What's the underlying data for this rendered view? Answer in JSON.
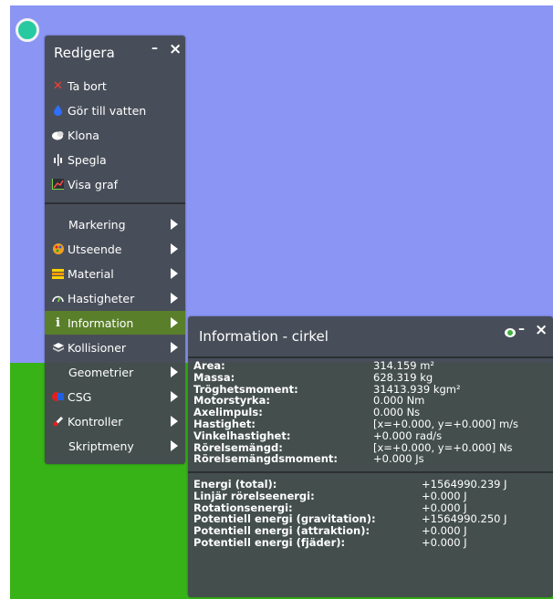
{
  "menu": {
    "title": "Redigera",
    "minimize": "–",
    "close": "×",
    "actions": [
      {
        "label": "Ta bort",
        "icon": "delete-x-icon"
      },
      {
        "label": "Gör till vatten",
        "icon": "water-drop-icon"
      },
      {
        "label": "Klona",
        "icon": "clone-icon"
      },
      {
        "label": "Spegla",
        "icon": "mirror-icon"
      },
      {
        "label": "Visa graf",
        "icon": "graph-icon"
      }
    ],
    "submenus": [
      {
        "label": "Markering",
        "icon": ""
      },
      {
        "label": "Utseende",
        "icon": "palette-icon"
      },
      {
        "label": "Material",
        "icon": "material-icon"
      },
      {
        "label": "Hastigheter",
        "icon": "speedometer-icon"
      },
      {
        "label": "Information",
        "icon": "info-icon"
      },
      {
        "label": "Kollisioner",
        "icon": "collision-icon"
      },
      {
        "label": "Geometrier",
        "icon": ""
      },
      {
        "label": "CSG",
        "icon": "csg-icon"
      },
      {
        "label": "Kontroller",
        "icon": "controller-icon"
      },
      {
        "label": "Skriptmeny",
        "icon": ""
      }
    ]
  },
  "info": {
    "title": "Information - cirkel",
    "visibility_icon": "eye-icon",
    "minimize": "–",
    "close": "×",
    "properties": [
      {
        "label": "Area:",
        "value": "314.159 m²"
      },
      {
        "label": "Massa:",
        "value": "628.319 kg"
      },
      {
        "label": "Tröghetsmoment:",
        "value": "31413.939 kgm²"
      },
      {
        "label": "Motorstyrka:",
        "value": "0.000 Nm"
      },
      {
        "label": "Axelimpuls:",
        "value": "0.000 Ns"
      },
      {
        "label": "Hastighet:",
        "value": "[x=+0.000, y=+0.000] m/s"
      },
      {
        "label": "Vinkelhastighet:",
        "value": "+0.000 rad/s"
      },
      {
        "label": "Rörelsemängd:",
        "value": "[x=+0.000, y=+0.000] Ns"
      },
      {
        "label": "Rörelsemängdsmoment:",
        "value": "+0.000 Js"
      }
    ],
    "energy": [
      {
        "label": "Energi (total):",
        "value": "+1564990.239 J"
      },
      {
        "label": "Linjär rörelseenergi:",
        "value": "+0.000 J"
      },
      {
        "label": "Rotationsenergi:",
        "value": "+0.000 J"
      },
      {
        "label": "Potentiell energi (gravitation):",
        "value": "+1564990.250 J"
      },
      {
        "label": "Potentiell energi (attraktion):",
        "value": "+0.000 J"
      },
      {
        "label": "Potentiell energi (fjäder):",
        "value": "+0.000 J"
      }
    ]
  },
  "colors": {
    "sky": "#8b95f4",
    "ground": "#37b317",
    "panel": "#444a50",
    "active": "#5a7f2a"
  }
}
